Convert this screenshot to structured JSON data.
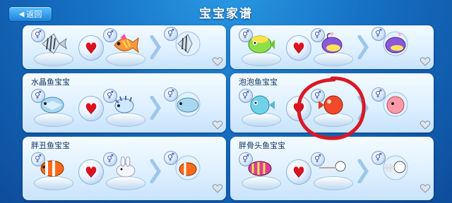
{
  "header": {
    "back_label": "返回",
    "title": "宝宝家谱"
  },
  "cards": [
    {
      "name": "",
      "gender_symbol": "⚥",
      "heart_symbol": "♥",
      "result_shown": true
    },
    {
      "name": "",
      "gender_symbol": "⚥",
      "heart_symbol": "♥",
      "result_shown": true
    },
    {
      "name": "水晶鱼宝宝",
      "gender_symbol": "⚥",
      "heart_symbol": "♥",
      "result_shown": true
    },
    {
      "name": "泡泡鱼宝宝",
      "gender_symbol": "⚥",
      "heart_symbol": "♥",
      "result_shown": true
    },
    {
      "name": "胖丑鱼宝宝",
      "gender_symbol": "⚥",
      "heart_symbol": "♥",
      "result_shown": true
    },
    {
      "name": "胖骨头鱼宝宝",
      "gender_symbol": "⚥",
      "heart_symbol": "♥",
      "result_shown": true
    }
  ],
  "colors": {
    "background": "#1670c4",
    "heart": "#e0101e",
    "annotation": "#d81826"
  },
  "icons": {
    "back": "back-arrow-icon",
    "gender": "gender-icon",
    "heart": "heart-icon",
    "arrow": "chevron-right-icon",
    "favorite": "heart-outline-icon"
  }
}
